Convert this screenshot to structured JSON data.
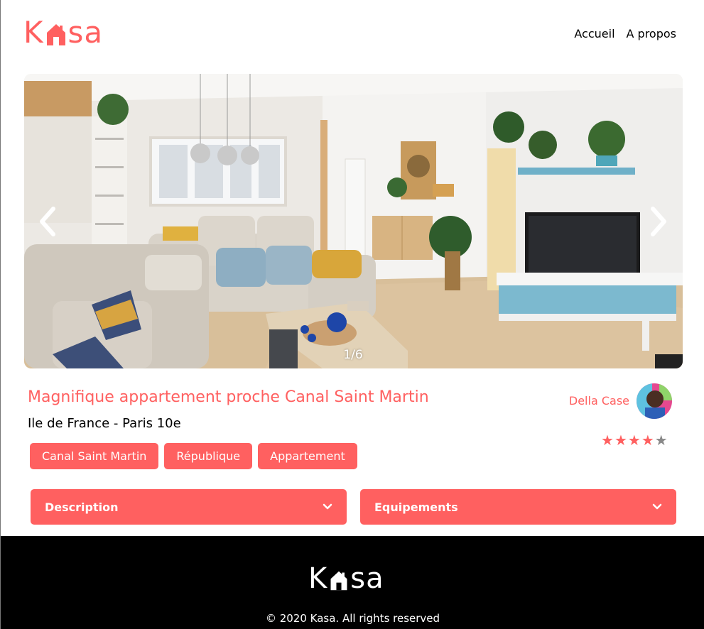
{
  "brand": {
    "logo_prefix": "K",
    "logo_suffix": "sa",
    "accent": "#FF6060"
  },
  "nav": {
    "home": "Accueil",
    "about": "A propos"
  },
  "gallery": {
    "counter": "1/6",
    "prev_icon": "chevron-left-icon",
    "next_icon": "chevron-right-icon"
  },
  "listing": {
    "title": "Magnifique appartement proche Canal Saint Martin",
    "location": "Ile de France - Paris 10e",
    "tags": [
      "Canal Saint Martin",
      "République",
      "Appartement"
    ]
  },
  "host": {
    "name": "Della Case",
    "rating": 4,
    "rating_max": 5
  },
  "collapses": {
    "description": "Description",
    "equipments": "Equipements"
  },
  "footer": {
    "copyright": "© 2020 Kasa. All rights reserved"
  }
}
